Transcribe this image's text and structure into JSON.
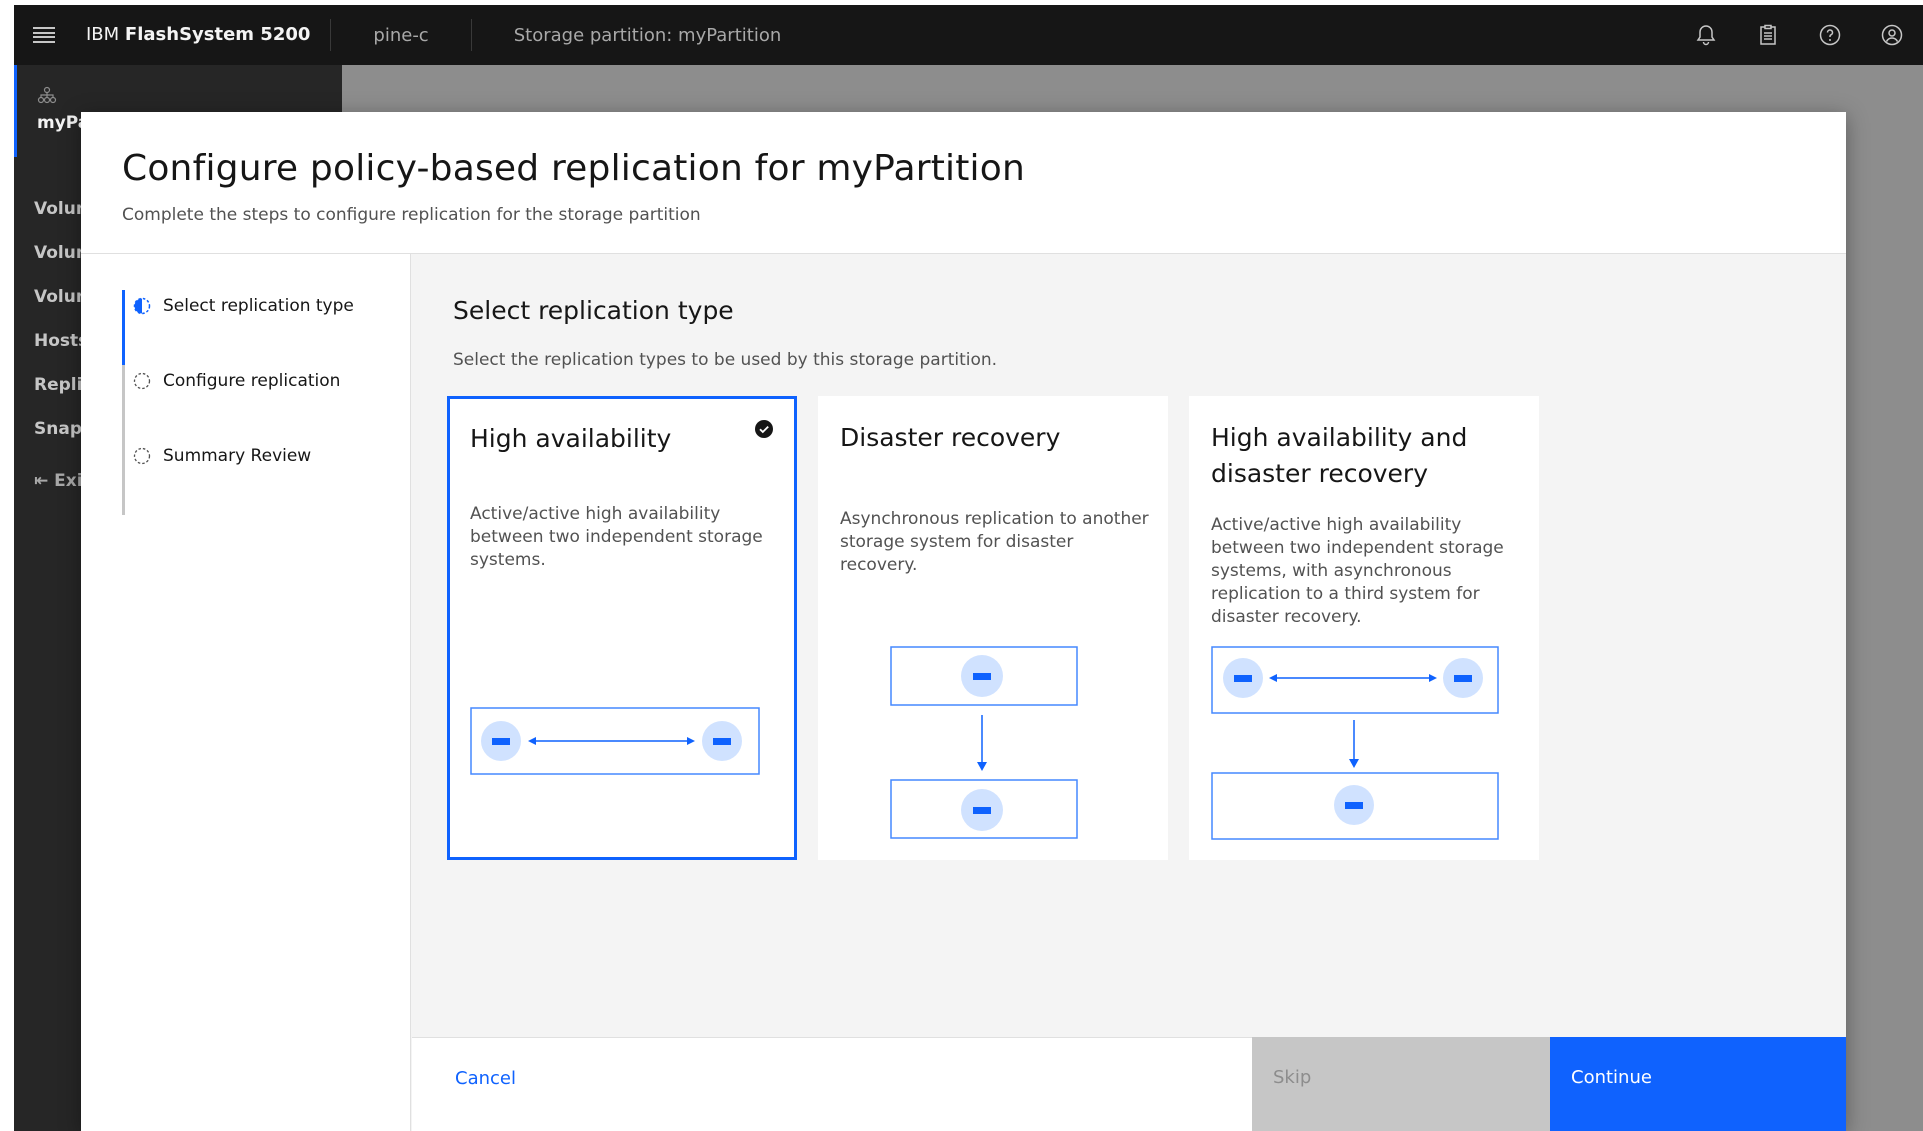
{
  "header": {
    "product_prefix": "IBM",
    "product_name": "FlashSystem 5200",
    "system": "pine-c",
    "partition": "Storage partition: myPartition",
    "icons": [
      "notification-icon",
      "clipboard-icon",
      "help-icon",
      "user-icon"
    ]
  },
  "sidebar": {
    "title": "myPart",
    "items": [
      {
        "label": "Volume"
      },
      {
        "label": "Volume"
      },
      {
        "label": "Volume"
      },
      {
        "label": "Hosts"
      },
      {
        "label": "Replica"
      },
      {
        "label": "Snapsh"
      }
    ],
    "exit_label": "Exit"
  },
  "modal": {
    "title": "Configure policy-based replication for myPartition",
    "subtitle": "Complete the steps to configure replication for the storage partition",
    "steps": [
      {
        "label": "Select replication type",
        "state": "current"
      },
      {
        "label": "Configure replication",
        "state": "incomplete"
      },
      {
        "label": "Summary Review",
        "state": "incomplete"
      }
    ],
    "content": {
      "title": "Select replication type",
      "description": "Select the replication types to be used by this storage partition."
    },
    "tiles": [
      {
        "title": "High availability",
        "description": "Active/active high availability between two independent storage systems.",
        "selected": true
      },
      {
        "title": "Disaster recovery",
        "description": "Asynchronous replication to another storage system for disaster recovery.",
        "selected": false
      },
      {
        "title": "High availability and disaster recovery",
        "description": "Active/active high availability between two independent storage systems, with asynchronous replication to a third system for disaster recovery.",
        "selected": false
      }
    ],
    "buttons": {
      "cancel": "Cancel",
      "skip": "Skip",
      "continue": "Continue"
    }
  },
  "colors": {
    "accent": "#0f62fe",
    "diagram_stroke": "#4589ff",
    "diagram_node": "#d0e2ff"
  }
}
